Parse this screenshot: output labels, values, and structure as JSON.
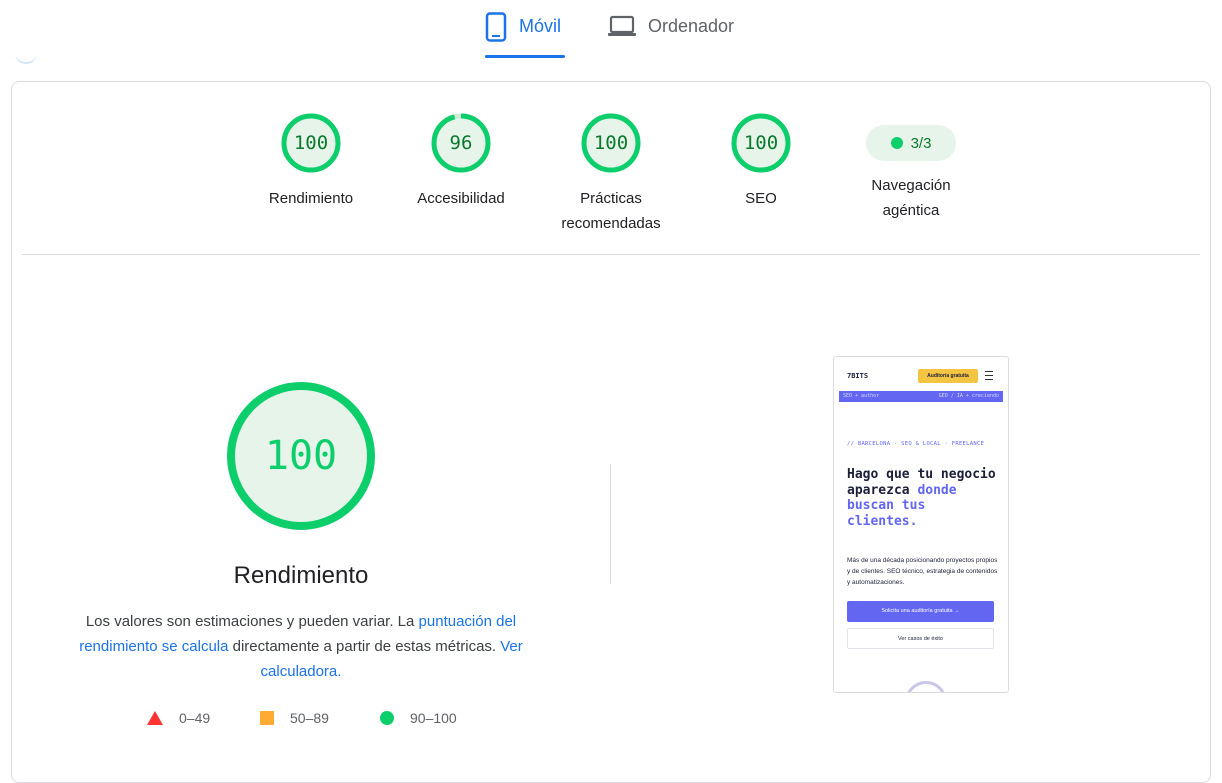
{
  "tabs": [
    {
      "label": "Móvil",
      "icon": "smartphone-icon",
      "active": true
    },
    {
      "label": "Ordenador",
      "icon": "laptop-icon",
      "active": false
    }
  ],
  "gauges": [
    {
      "label": "Rendimiento",
      "score": "100",
      "fraction": 1.0
    },
    {
      "label": "Accesibilidad",
      "score": "96",
      "fraction": 0.96
    },
    {
      "label_lines": [
        "Prácticas",
        "recomendadas"
      ],
      "score": "100",
      "fraction": 1.0
    },
    {
      "label": "SEO",
      "score": "100",
      "fraction": 1.0
    }
  ],
  "agentic": {
    "pill": "3/3",
    "label_lines": [
      "Navegación",
      "agéntica"
    ]
  },
  "performance": {
    "score": "100",
    "fraction": 1.0,
    "title": "Rendimiento",
    "desc_1": "Los valores son estimaciones y pueden variar. La ",
    "link_1": "puntuación del rendimiento se calcula",
    "desc_2": " directamente a partir de estas métricas. ",
    "link_2": "Ver calculadora."
  },
  "legend": [
    {
      "range": "0–49",
      "shape": "triangle",
      "color": "#ff3333"
    },
    {
      "range": "50–89",
      "shape": "square",
      "color": "#ffaa33"
    },
    {
      "range": "90–100",
      "shape": "circle",
      "color": "#0cce6b"
    }
  ],
  "screenshot": {
    "logo": "7BITS",
    "cta_top": "Auditoría gratuita",
    "ticker_left": "SEO + author",
    "ticker_right": "GEO / IA + creciendo",
    "kicker": "// BARCELONA · SEO & LOCAL · FREELANCE",
    "headline_1": "Hago que tu negocio aparezca ",
    "headline_2": "donde buscan tus clientes.",
    "body": "Más de una década posicionando proyectos propios y de clientes. SEO técnico, estrategia de contenidos y automatizaciones.",
    "btn_primary": "Solicita una auditoría gratuita →",
    "btn_secondary": "Ver casos de éxito"
  },
  "colors": {
    "pass": "#0cce6b",
    "pass_bg": "#e6f4ea",
    "link": "#1a73e8"
  }
}
